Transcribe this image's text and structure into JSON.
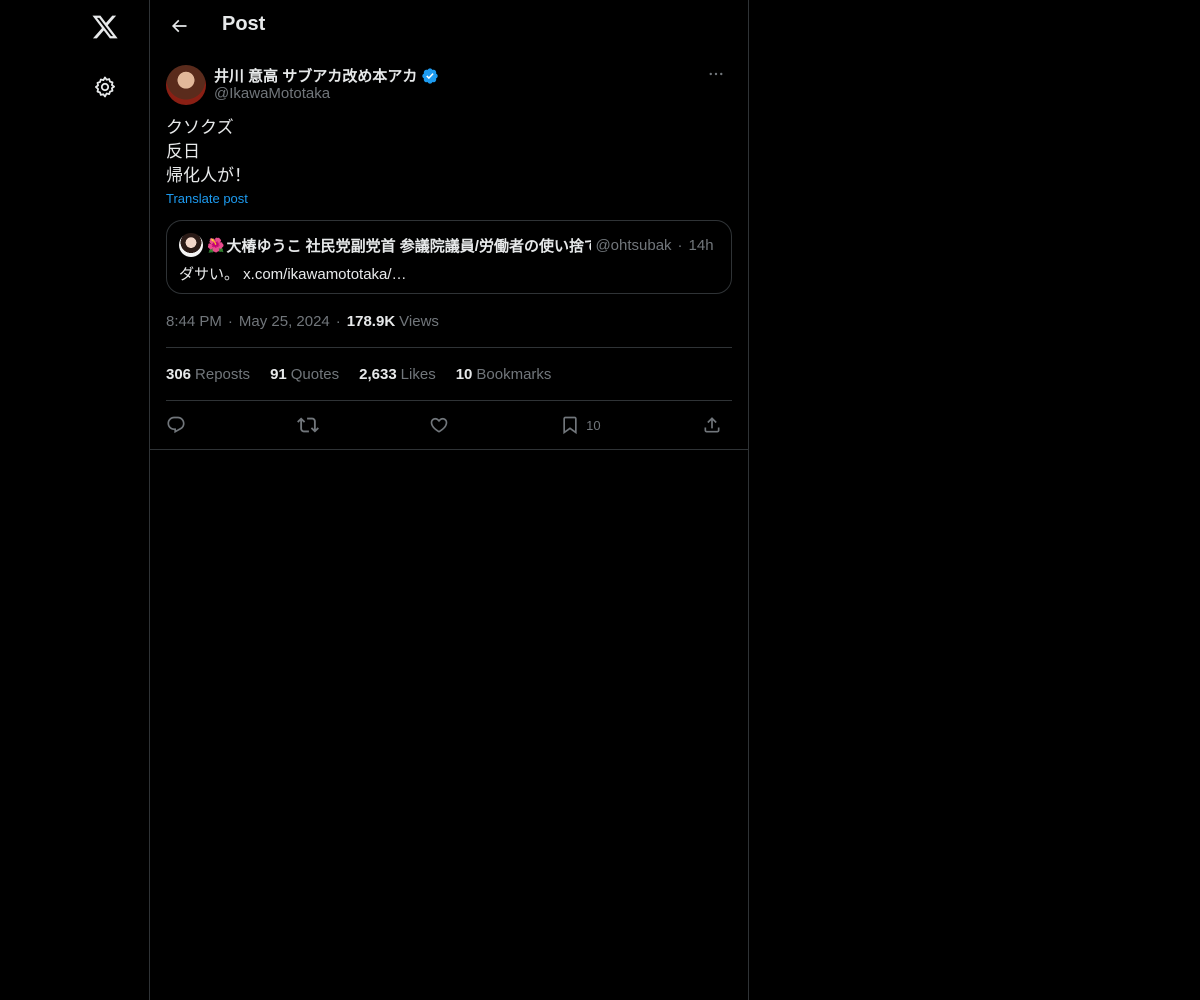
{
  "nav": {
    "logo_icon": "x-logo-icon",
    "settings_icon": "gear-icon"
  },
  "header": {
    "title": "Post",
    "back_icon": "arrow-left-icon"
  },
  "post": {
    "author": {
      "name": "井川 意高 サブアカ改め本アカ",
      "handle": "@IkawaMototaka",
      "verified": true
    },
    "text_lines": [
      "クソクズ",
      "反日",
      "帰化人が！"
    ],
    "translate_label": "Translate post",
    "quote": {
      "emoji": "🌺",
      "name": "大椿ゆうこ 社民党副党首 参議院議員/労働者の使い捨て",
      "handle": "@ohtsubak",
      "dot": "·",
      "time": "14h",
      "text": "ダサい。 x.com/ikawamototaka/…"
    },
    "meta": {
      "time": "8:44 PM",
      "date": "May 25, 2024",
      "views_count": "178.9K",
      "views_label": "Views"
    },
    "stats": [
      {
        "num": "306",
        "label": "Reposts"
      },
      {
        "num": "91",
        "label": "Quotes"
      },
      {
        "num": "2,633",
        "label": "Likes"
      },
      {
        "num": "10",
        "label": "Bookmarks"
      }
    ],
    "actions": {
      "reply_icon": "reply-icon",
      "repost_icon": "repost-icon",
      "like_icon": "heart-icon",
      "bookmark_icon": "bookmark-icon",
      "bookmark_count": "10",
      "share_icon": "share-icon"
    }
  },
  "colors": {
    "background": "#000000",
    "text": "#e7e9ea",
    "muted": "#71767b",
    "accent": "#1d9bf0",
    "border": "#2f3336"
  }
}
